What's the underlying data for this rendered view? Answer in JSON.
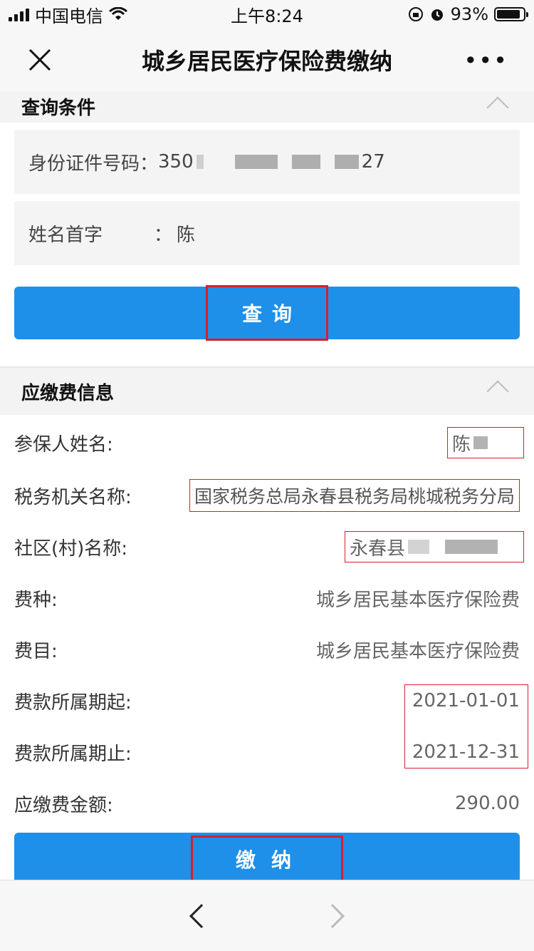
{
  "status_bar": {
    "carrier": "中国电信",
    "time": "上午8:24",
    "battery": "93%"
  },
  "nav": {
    "title": "城乡居民医疗保险费缴纳"
  },
  "query_section": {
    "title": "查询条件",
    "id_label": "身份证件号码：",
    "id_prefix": "350",
    "id_suffix": "27",
    "name_label": "姓名首字",
    "name_colon": "：",
    "name_value": "陈",
    "button": "查询"
  },
  "info_section": {
    "title": "应缴费信息",
    "rows": [
      {
        "label": "参保人姓名:",
        "value": "陈"
      },
      {
        "label": "税务机关名称:",
        "value": "国家税务总局永春县税务局桃城税务分局"
      },
      {
        "label": "社区(村)名称:",
        "value": "永春县"
      },
      {
        "label": "费种:",
        "value": "城乡居民基本医疗保险费"
      },
      {
        "label": "费目:",
        "value": "城乡居民基本医疗保险费"
      },
      {
        "label": "费款所属期起:",
        "value": "2021-01-01"
      },
      {
        "label": "费款所属期止:",
        "value": "2021-12-31"
      },
      {
        "label": "应缴费金额:",
        "value": "290.00"
      }
    ],
    "pay_button": "缴纳"
  },
  "colors": {
    "primary": "#1e90ea",
    "highlight": "#d4202b"
  }
}
